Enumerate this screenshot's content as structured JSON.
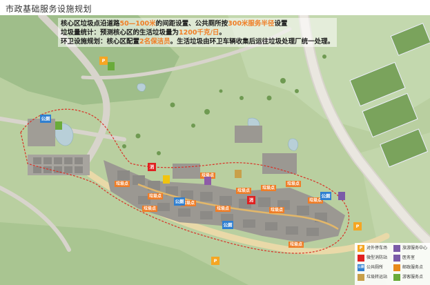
{
  "header": {
    "title": "市政基础服务设施规划"
  },
  "notes": {
    "line1": {
      "a": "核心区垃圾点沿道路",
      "b": "50—100米",
      "c": "的间距设置、公共厕所按",
      "d": "300米服务半径",
      "e": "设置"
    },
    "line2": {
      "a": "垃圾量统计：预测核心区的生活垃圾量为",
      "b": "1200千克/日",
      "c": "。"
    },
    "line3": {
      "a": "环卫设施规划：核心区配置",
      "b": "2名保洁员",
      "c": "。生活垃圾由环卫车辆收集后运往垃圾处理厂统一处理。"
    }
  },
  "map": {
    "marker_text": "垃圾点",
    "toilet_text": "公厕",
    "parking_text": "P",
    "police_text": "消"
  },
  "legend": {
    "items": [
      {
        "icon": "P",
        "label": "对外停车场",
        "color": "#f5a623"
      },
      {
        "icon": "",
        "label": "旅游服务中心",
        "color": "#7a5ba8"
      },
      {
        "icon": "",
        "label": "微型消防站",
        "color": "#e02020"
      },
      {
        "icon": "",
        "label": "医务室",
        "color": "#7a5ba8"
      },
      {
        "icon": "公厕",
        "label": "公共厕所",
        "color": "#2f7fd1"
      },
      {
        "icon": "",
        "label": "邮政服务点",
        "color": "#e88a1a"
      },
      {
        "icon": "",
        "label": "垃圾转运站",
        "color": "#c8a04a"
      },
      {
        "icon": "",
        "label": "游客服务点",
        "color": "#6aab3a"
      }
    ]
  },
  "colors": {
    "accent": "#f07e26",
    "boundary": "#d93025"
  }
}
